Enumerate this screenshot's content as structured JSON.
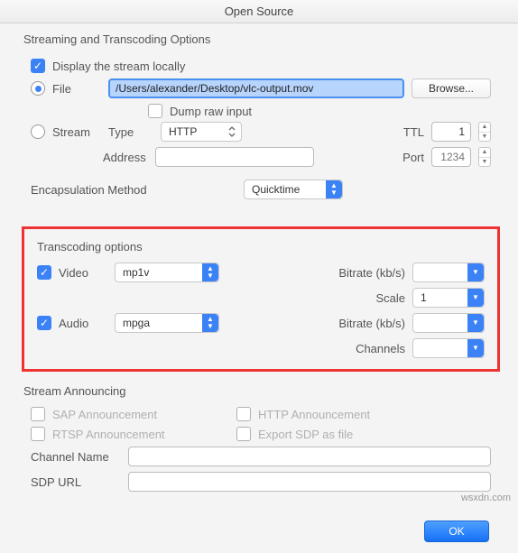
{
  "title": "Open Source",
  "streaming": {
    "section": "Streaming and Transcoding Options",
    "display_locally": "Display the stream locally",
    "file_label": "File",
    "file_value": "/Users/alexander/Desktop/vlc-output.mov",
    "browse": "Browse...",
    "dump_raw": "Dump raw input",
    "stream_label": "Stream",
    "type_label": "Type",
    "type_value": "HTTP",
    "ttl_label": "TTL",
    "ttl_value": "1",
    "address_label": "Address",
    "port_label": "Port",
    "port_placeholder": "1234",
    "encap_label": "Encapsulation Method",
    "encap_value": "Quicktime"
  },
  "transcoding": {
    "section": "Transcoding options",
    "video_label": "Video",
    "video_codec": "mp1v",
    "video_bitrate_label": "Bitrate (kb/s)",
    "scale_label": "Scale",
    "scale_value": "1",
    "audio_label": "Audio",
    "audio_codec": "mpga",
    "audio_bitrate_label": "Bitrate (kb/s)",
    "channels_label": "Channels"
  },
  "announcing": {
    "section": "Stream Announcing",
    "sap": "SAP Announcement",
    "rtsp": "RTSP Announcement",
    "http": "HTTP Announcement",
    "export_sdp": "Export SDP as file",
    "channel_name": "Channel Name",
    "sdp_url": "SDP URL"
  },
  "footer": {
    "ok": "OK"
  },
  "watermark": "wsxdn.com"
}
